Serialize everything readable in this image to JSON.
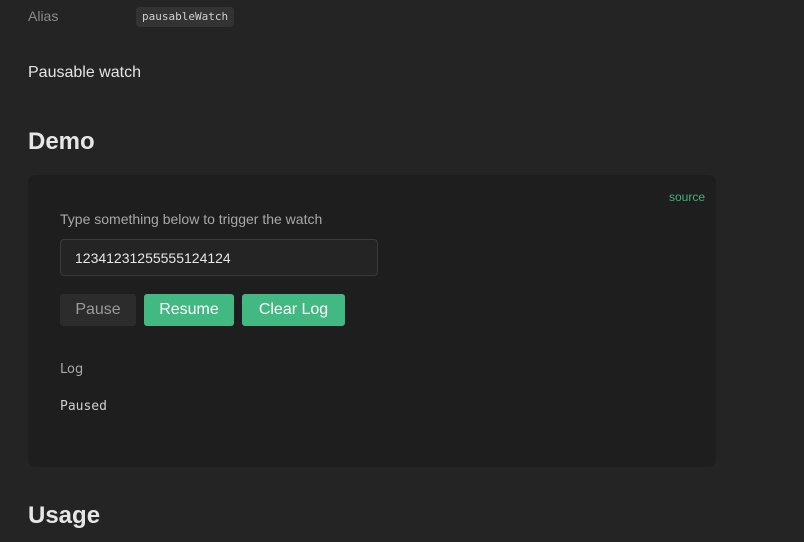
{
  "alias": {
    "label": "Alias",
    "value": "pausableWatch"
  },
  "description": "Pausable watch",
  "demo": {
    "heading": "Demo",
    "source_link": "source",
    "prompt": "Type something below to trigger the watch",
    "input_value": "12341231255555124124",
    "buttons": {
      "pause": "Pause",
      "resume": "Resume",
      "clear": "Clear Log"
    },
    "log_label": "Log",
    "log_value": "Paused"
  },
  "usage": {
    "heading": "Usage"
  },
  "colors": {
    "accent": "#42b883",
    "background": "#242424",
    "card": "#1e1e1e"
  }
}
